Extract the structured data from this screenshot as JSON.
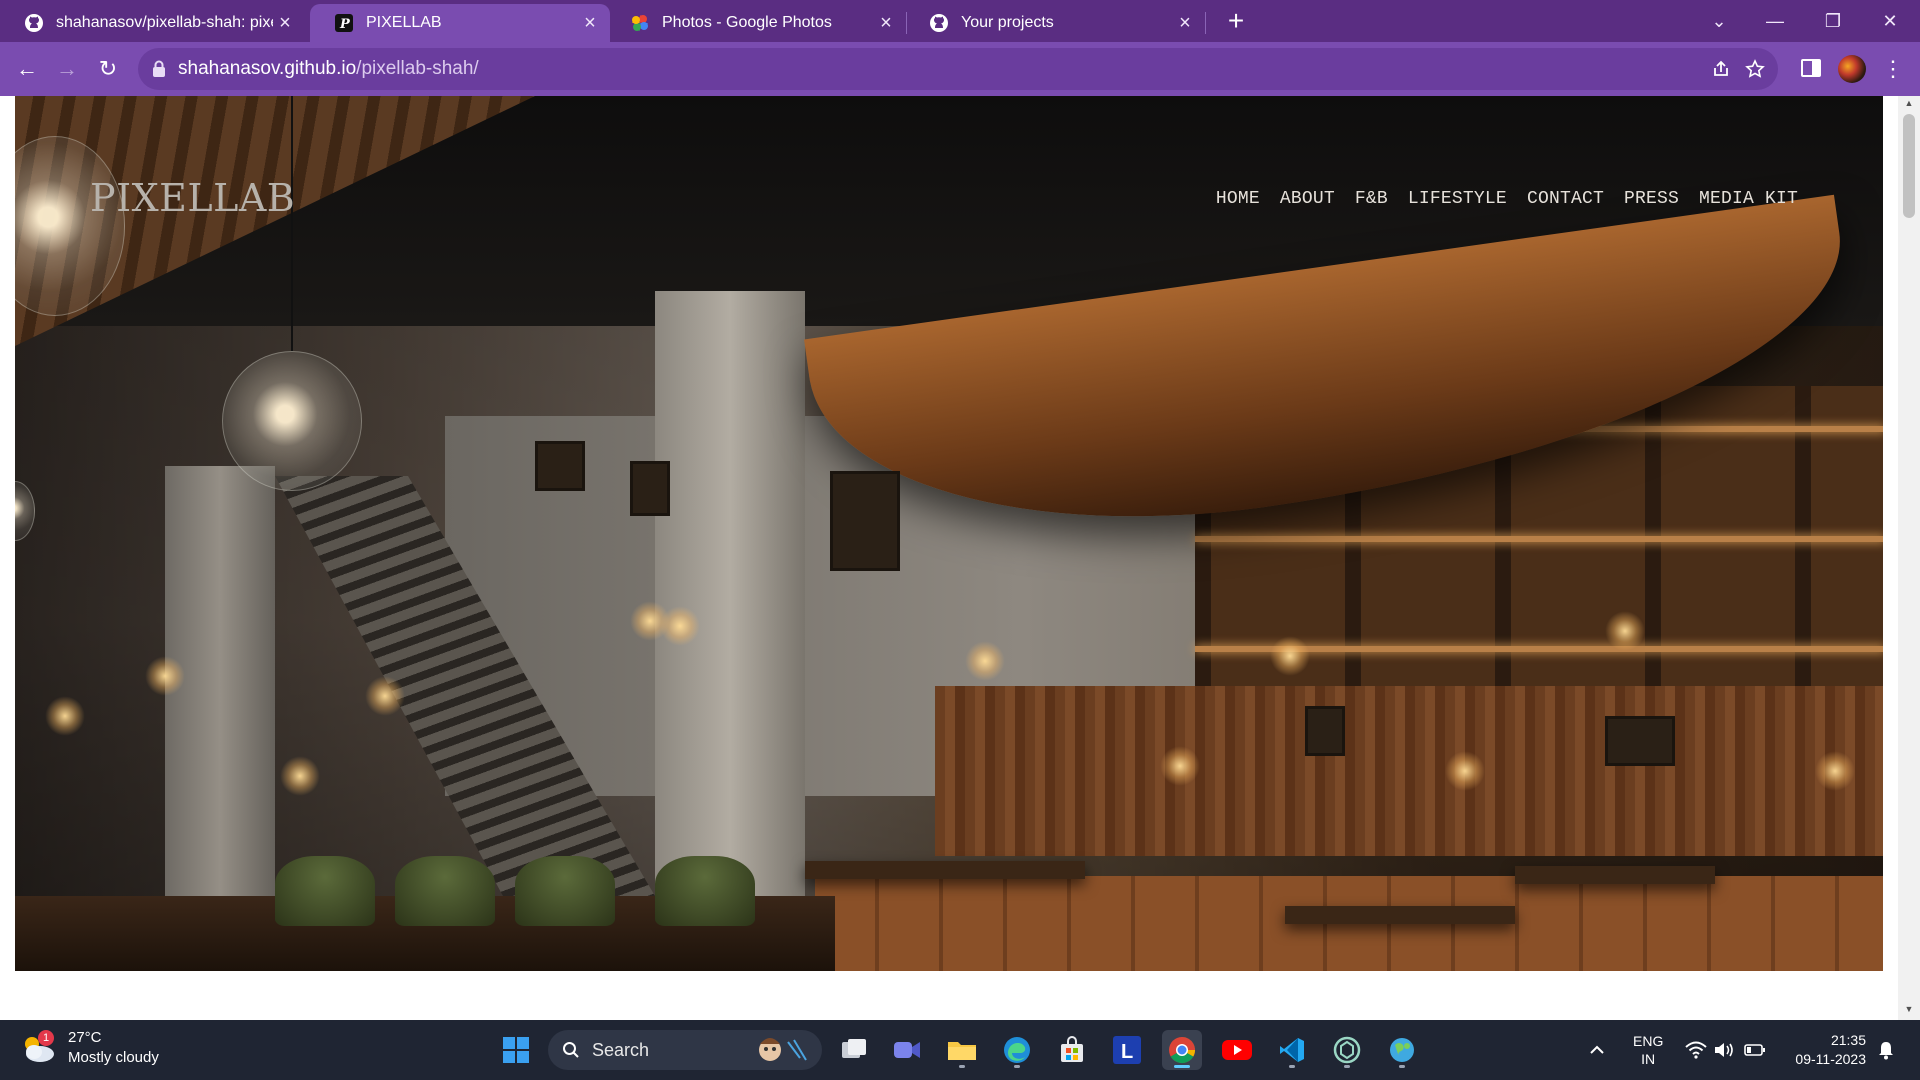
{
  "browser": {
    "tabs": [
      {
        "title": "shahanasov/pixellab-shah: pixell",
        "favicon": "github-icon",
        "active": false
      },
      {
        "title": "PIXELLAB",
        "favicon": "pixellab-p-icon",
        "active": true
      },
      {
        "title": "Photos - Google Photos",
        "favicon": "google-photos-icon",
        "active": false
      },
      {
        "title": "Your projects",
        "favicon": "github-icon",
        "active": false
      }
    ],
    "close_glyph": "×",
    "new_tab_glyph": "+",
    "window_controls": {
      "tab_search": "⌄",
      "minimize": "—",
      "restore": "❐",
      "close": "✕"
    },
    "nav": {
      "back": "←",
      "forward": "→",
      "reload": "↻"
    },
    "url_host": "shahanasov.github.io",
    "url_path": "/pixellab-shah/",
    "menu_glyph": "⋮",
    "colors": {
      "frame": "#5a2d82",
      "toolbar": "#7a4cb0"
    }
  },
  "site": {
    "logo": "PIXELLAB",
    "nav": [
      "HOME",
      "ABOUT",
      "F&B",
      "LIFESTYLE",
      "CONTACT",
      "PRESS",
      "MEDIA KIT"
    ],
    "hero_image": "restaurant interior with canoe sculpture, pendant glass lamps, staircase and leather banquettes"
  },
  "taskbar": {
    "weather": {
      "badge": "1",
      "temp": "27°C",
      "desc": "Mostly cloudy"
    },
    "search_label": "Search",
    "apps": [
      "windows-start-icon",
      "search",
      "task-view-icon",
      "teams-meet-icon",
      "file-explorer-icon",
      "edge-icon",
      "microsoft-store-icon",
      "launcher-l-icon",
      "chrome-icon",
      "youtube-icon",
      "vscode-icon",
      "chatgpt-icon",
      "browser-globe-icon"
    ],
    "lang": {
      "line1": "ENG",
      "line2": "IN"
    },
    "clock": {
      "time": "21:35",
      "date": "09-11-2023"
    }
  }
}
